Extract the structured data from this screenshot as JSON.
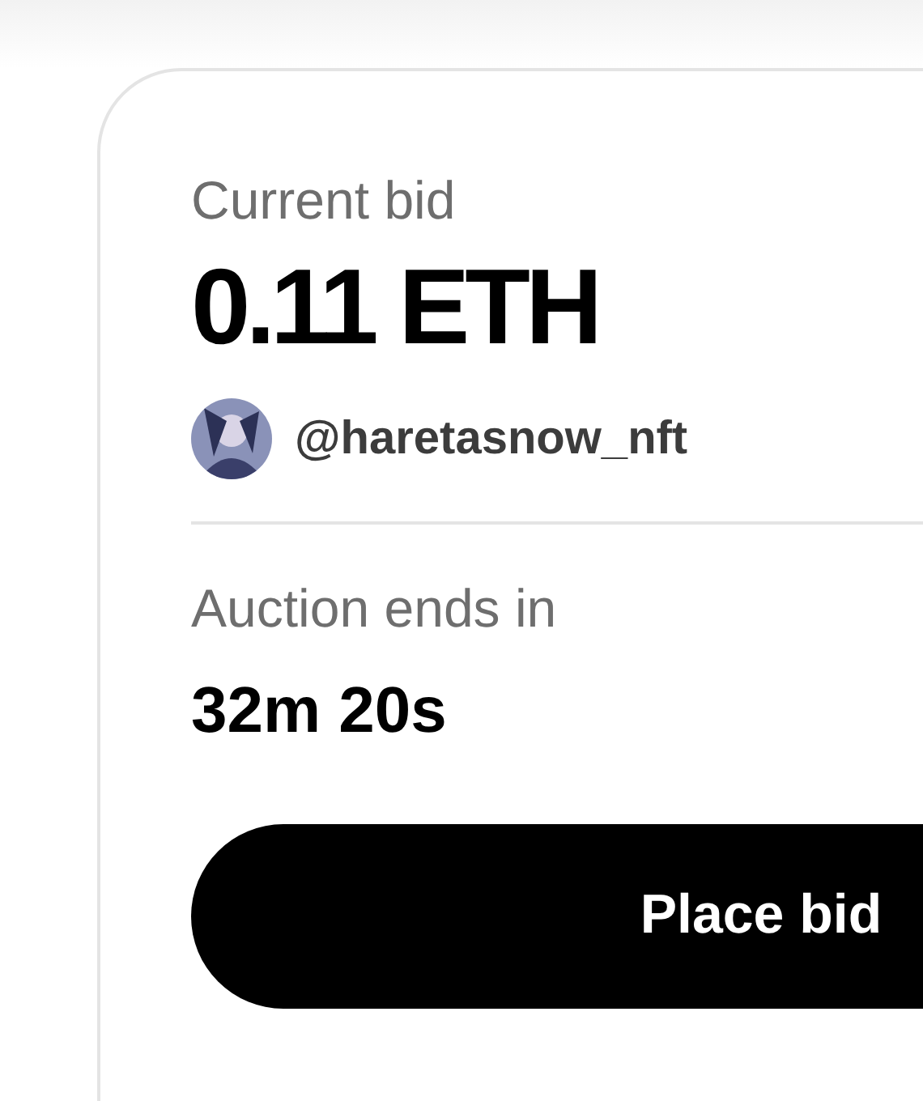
{
  "current_bid": {
    "label": "Current bid",
    "amount": "0.11 ETH",
    "bidder": "@haretasnow_nft"
  },
  "auction": {
    "label": "Auction ends in",
    "time_left": "32m 20s"
  },
  "button": {
    "label": "Place bid"
  }
}
